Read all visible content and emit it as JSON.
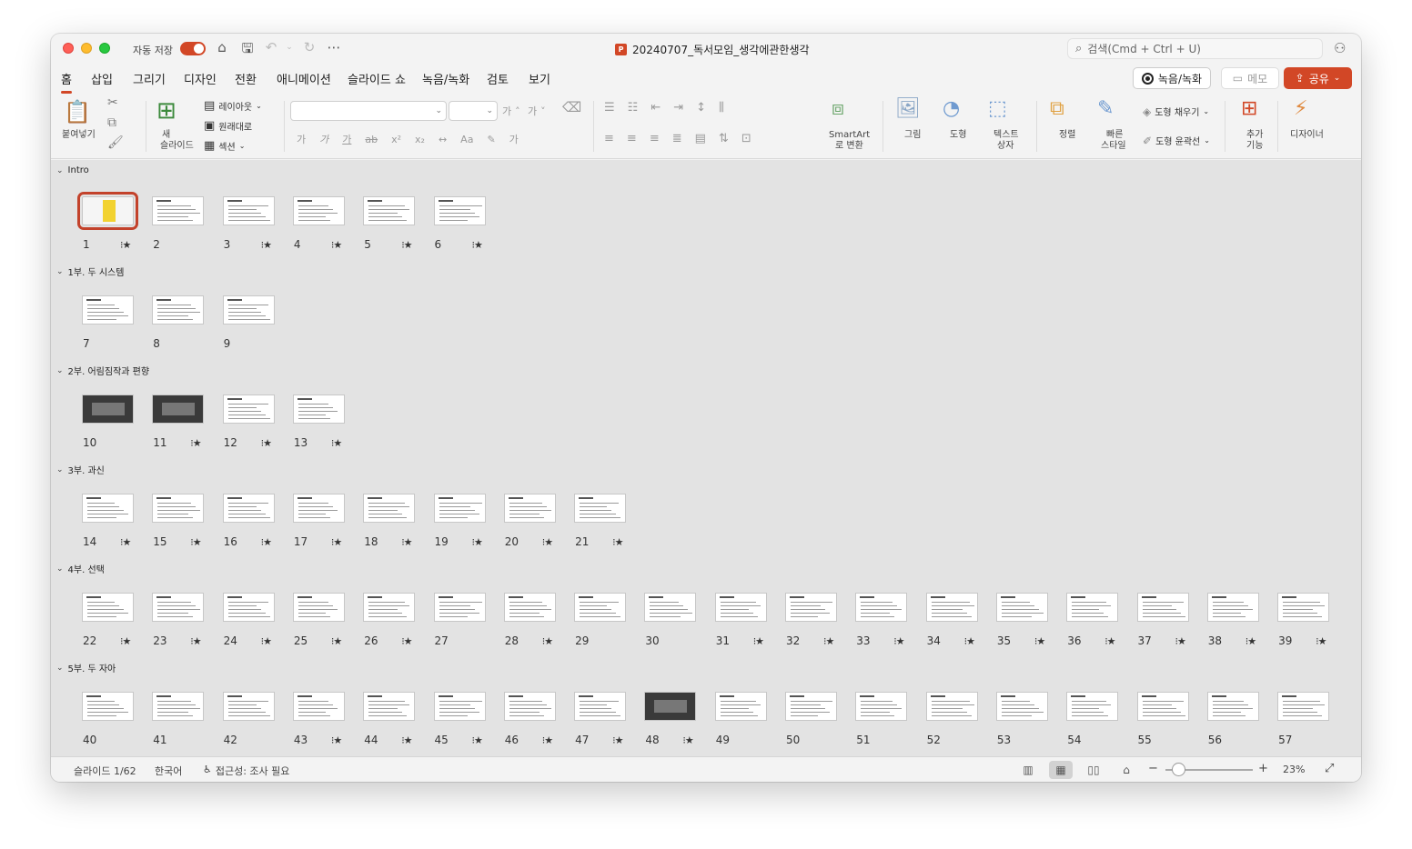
{
  "titlebar": {
    "autosave_label": "자동 저장",
    "doc_title": "20240707_독서모임_생각에관한생각",
    "search_placeholder": "검색(Cmd + Ctrl + U)"
  },
  "tabs": [
    "홈",
    "삽입",
    "그리기",
    "디자인",
    "전환",
    "애니메이션",
    "슬라이드 쇼",
    "녹음/녹화",
    "검토",
    "보기"
  ],
  "active_tab": "홈",
  "header_buttons": {
    "record": "녹음/녹화",
    "memo": "메모",
    "share": "공유"
  },
  "ribbon": {
    "paste": "붙여넣기",
    "new_slide_1": "새",
    "new_slide_2": "슬라이드",
    "layout": "레이아웃",
    "reset": "원래대로",
    "section": "섹션",
    "font_sample_1": "가",
    "font_sample_2": "가",
    "font_sample_3": "가",
    "font_sample_4": "가",
    "smartart_1": "SmartArt",
    "smartart_2": "로 변환",
    "picture": "그림",
    "shape": "도형",
    "textbox_1": "텍스트",
    "textbox_2": "상자",
    "arrange": "정렬",
    "quickstyle_1": "빠른",
    "quickstyle_2": "스타일",
    "shape_fill": "도형 채우기",
    "shape_outline": "도형 윤곽선",
    "addins_1": "추가",
    "addins_2": "기능",
    "designer": "디자이너"
  },
  "sections": [
    {
      "name": "Intro",
      "slides": [
        {
          "n": "1",
          "star": true
        },
        {
          "n": "2",
          "star": false
        },
        {
          "n": "3",
          "star": true
        },
        {
          "n": "4",
          "star": true
        },
        {
          "n": "5",
          "star": true
        },
        {
          "n": "6",
          "star": true
        }
      ]
    },
    {
      "name": "1부. 두 시스템",
      "slides": [
        {
          "n": "7",
          "star": false
        },
        {
          "n": "8",
          "star": false
        },
        {
          "n": "9",
          "star": false
        }
      ]
    },
    {
      "name": "2부. 어림짐작과 편향",
      "slides": [
        {
          "n": "10",
          "star": false
        },
        {
          "n": "11",
          "star": true
        },
        {
          "n": "12",
          "star": true
        },
        {
          "n": "13",
          "star": true
        }
      ]
    },
    {
      "name": "3부. 과신",
      "slides": [
        {
          "n": "14",
          "star": true
        },
        {
          "n": "15",
          "star": true
        },
        {
          "n": "16",
          "star": true
        },
        {
          "n": "17",
          "star": true
        },
        {
          "n": "18",
          "star": true
        },
        {
          "n": "19",
          "star": true
        },
        {
          "n": "20",
          "star": true
        },
        {
          "n": "21",
          "star": true
        }
      ]
    },
    {
      "name": "4부. 선택",
      "slides": [
        {
          "n": "22",
          "star": true
        },
        {
          "n": "23",
          "star": true
        },
        {
          "n": "24",
          "star": true
        },
        {
          "n": "25",
          "star": true
        },
        {
          "n": "26",
          "star": true
        },
        {
          "n": "27",
          "star": false
        },
        {
          "n": "28",
          "star": true
        },
        {
          "n": "29",
          "star": false
        },
        {
          "n": "30",
          "star": false
        },
        {
          "n": "31",
          "star": true
        },
        {
          "n": "32",
          "star": true
        },
        {
          "n": "33",
          "star": true
        },
        {
          "n": "34",
          "star": true
        },
        {
          "n": "35",
          "star": true
        },
        {
          "n": "36",
          "star": true
        },
        {
          "n": "37",
          "star": true
        },
        {
          "n": "38",
          "star": true
        },
        {
          "n": "39",
          "star": true
        }
      ]
    },
    {
      "name": "5부. 두 자아",
      "slides": [
        {
          "n": "40",
          "star": false
        },
        {
          "n": "41",
          "star": false
        },
        {
          "n": "42",
          "star": false
        },
        {
          "n": "43",
          "star": true
        },
        {
          "n": "44",
          "star": true
        },
        {
          "n": "45",
          "star": true
        },
        {
          "n": "46",
          "star": true
        },
        {
          "n": "47",
          "star": true
        },
        {
          "n": "48",
          "star": true
        },
        {
          "n": "49",
          "star": false
        },
        {
          "n": "50",
          "star": false
        },
        {
          "n": "51",
          "star": false
        },
        {
          "n": "52",
          "star": false
        },
        {
          "n": "53",
          "star": false
        },
        {
          "n": "54",
          "star": false
        },
        {
          "n": "55",
          "star": false
        },
        {
          "n": "56",
          "star": false
        },
        {
          "n": "57",
          "star": false
        }
      ]
    }
  ],
  "selected_slide": "1",
  "status": {
    "slide_counter": "슬라이드 1/62",
    "language": "한국어",
    "accessibility": "접근성: 조사 필요",
    "zoom": "23%",
    "zoom_fraction": 0.1
  }
}
